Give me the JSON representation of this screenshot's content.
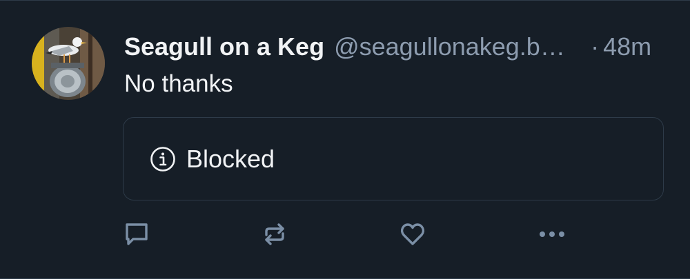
{
  "post": {
    "display_name": "Seagull on a Keg",
    "handle": "@seagullonakeg.bsky.social",
    "separator": "·",
    "time": "48m",
    "text": "No thanks"
  },
  "embed": {
    "icon": "info-icon",
    "label": "Blocked"
  },
  "actions": [
    {
      "name": "reply",
      "icon": "speech-bubble-icon"
    },
    {
      "name": "repost",
      "icon": "repost-arrows-icon"
    },
    {
      "name": "like",
      "icon": "heart-icon"
    },
    {
      "name": "more",
      "icon": "ellipsis-icon"
    }
  ],
  "colors": {
    "background": "#161e27",
    "text": "#f1f3f5",
    "muted": "#8d9caf",
    "icon": "#7b8fa6",
    "border": "#2e3b49"
  }
}
